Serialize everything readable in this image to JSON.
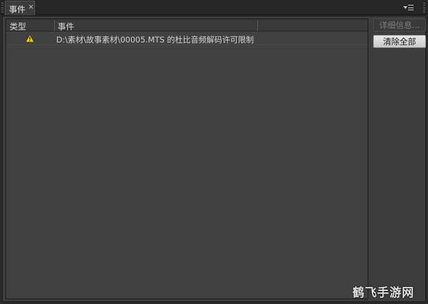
{
  "tab": {
    "label": "事件",
    "close": "×"
  },
  "columns": {
    "type": "类型",
    "event": "事件"
  },
  "rows": [
    {
      "icon": "warning-icon",
      "text": "D:\\素材\\故事素材\\00005.MTS 的杜比音频解码许可限制"
    }
  ],
  "buttons": {
    "details": "详细信息...",
    "clear_all": "清除全部"
  },
  "colors": {
    "warning": "#f5d000"
  },
  "watermark": "鹤飞手游网"
}
